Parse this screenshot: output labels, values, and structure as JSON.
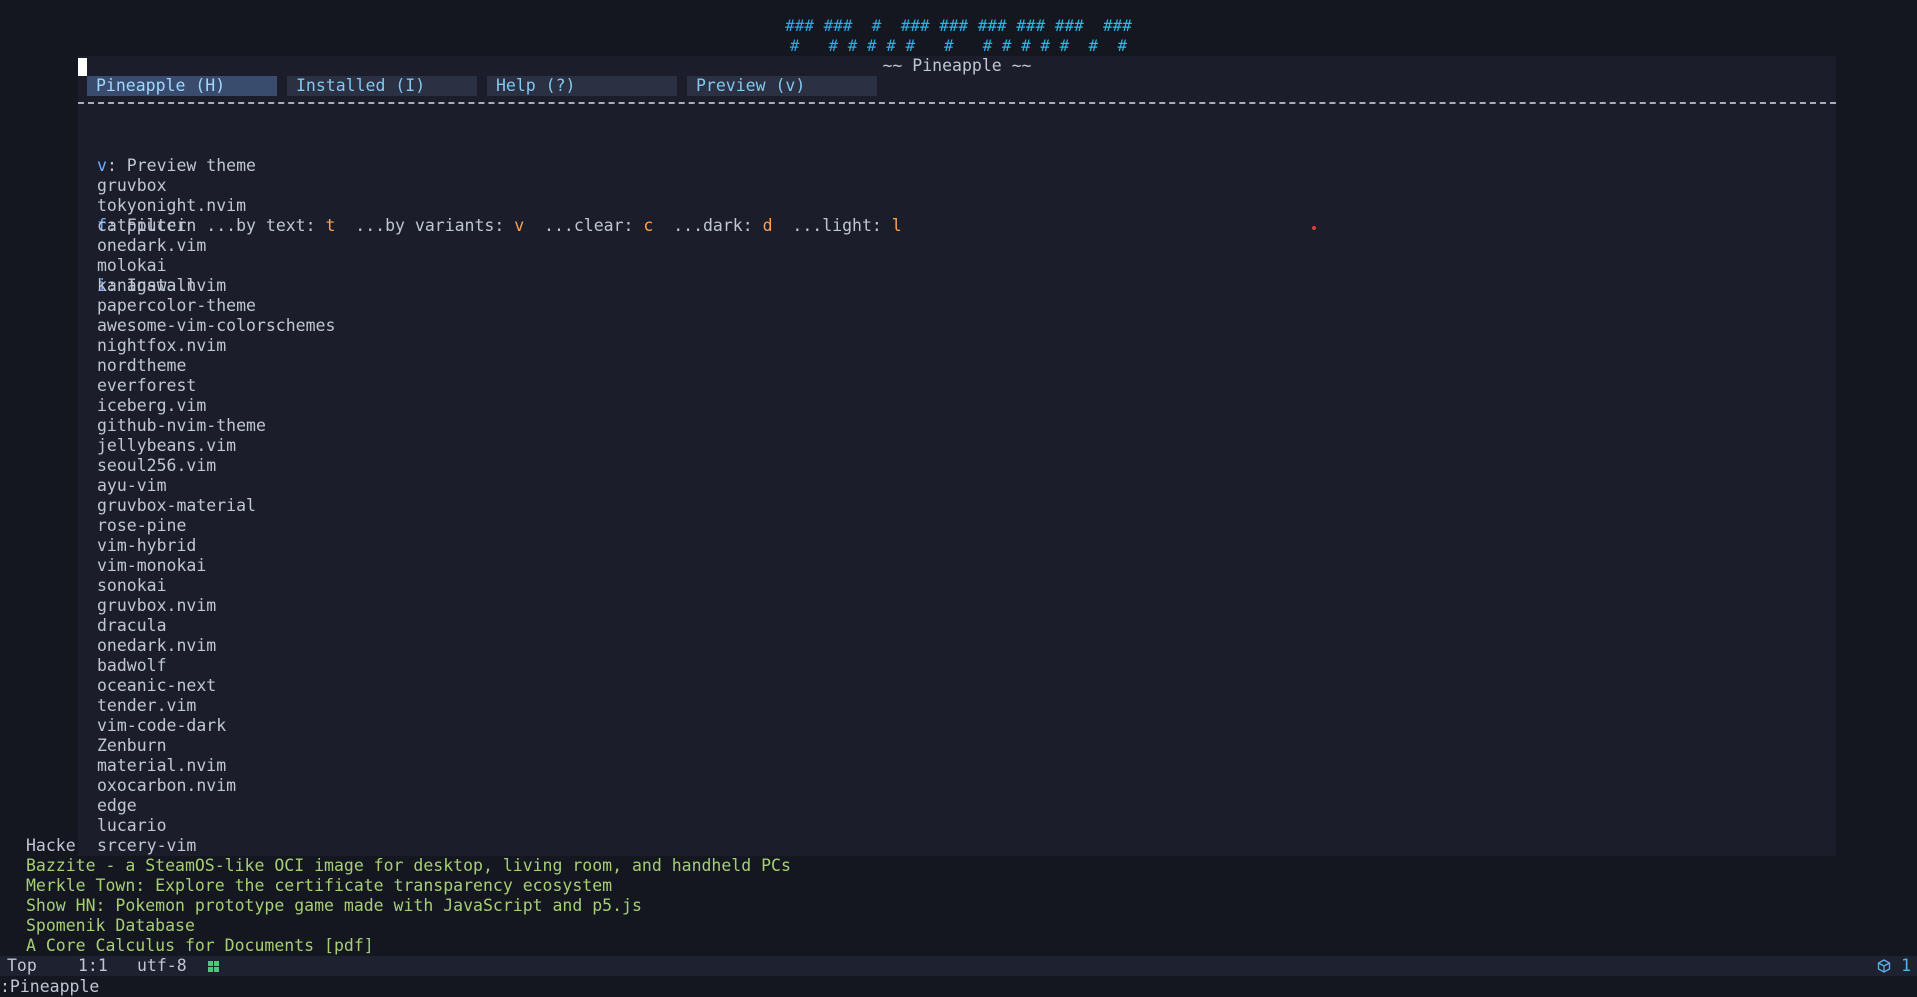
{
  "banner": {
    "line1": "### ###  #  ### ### ### ### ###  ###",
    "line2": "#   # # # # #   #   # # # # #  #  #"
  },
  "window": {
    "title": "~~ Pineapple ~~",
    "tabs": [
      {
        "label": "Pineapple (H)",
        "active": true
      },
      {
        "label": "Installed (I)",
        "active": false
      },
      {
        "label": "Help (?)",
        "active": false
      },
      {
        "label": "Preview (v)",
        "active": false
      }
    ],
    "help": {
      "preview": {
        "key": "v",
        "text": ": Preview theme"
      },
      "filter": {
        "key": "f",
        "text": ": Filter  ...by text: ",
        "text_key": "t",
        "variants_text": "  ...by variants: ",
        "variants_key": "v",
        "clear_text": "  ...clear: ",
        "clear_key": "c",
        "dark_text": "  ...dark: ",
        "dark_key": "d",
        "light_text": "  ...light: ",
        "light_key": "l"
      },
      "install": {
        "key": "i",
        "text": ": Install"
      }
    },
    "themes": [
      "gruvbox",
      "tokyonight.nvim",
      "catppuccin",
      "onedark.vim",
      "molokai",
      "kanagawa.nvim",
      "papercolor-theme",
      "awesome-vim-colorschemes",
      "nightfox.nvim",
      "nordtheme",
      "everforest",
      "iceberg.vim",
      "github-nvim-theme",
      "jellybeans.vim",
      "seoul256.vim",
      "ayu-vim",
      "gruvbox-material",
      "rose-pine",
      "vim-hybrid",
      "vim-monokai",
      "sonokai",
      "gruvbox.nvim",
      "dracula",
      "onedark.nvim",
      "badwolf",
      "oceanic-next",
      "tender.vim",
      "vim-code-dark",
      "Zenburn",
      "material.nvim",
      "oxocarbon.nvim",
      "edge",
      "lucario",
      "srcery-vim"
    ]
  },
  "background": {
    "partial_title": "Hacke",
    "news": [
      "Bazzite - a SteamOS-like OCI image for desktop, living room, and handheld PCs",
      "Merkle Town: Explore the certificate transparency ecosystem",
      "Show HN: Pokemon prototype game made with JavaScript and p5.js",
      "Spomenik Database",
      "A Core Calculus for Documents [pdf]"
    ]
  },
  "statusline": {
    "position": "Top",
    "cursor": "1:1",
    "encoding": "utf-8",
    "os_icon": "windows-icon",
    "package_icon": "package-icon",
    "package_count": "1"
  },
  "cmdline": ":Pineapple"
}
